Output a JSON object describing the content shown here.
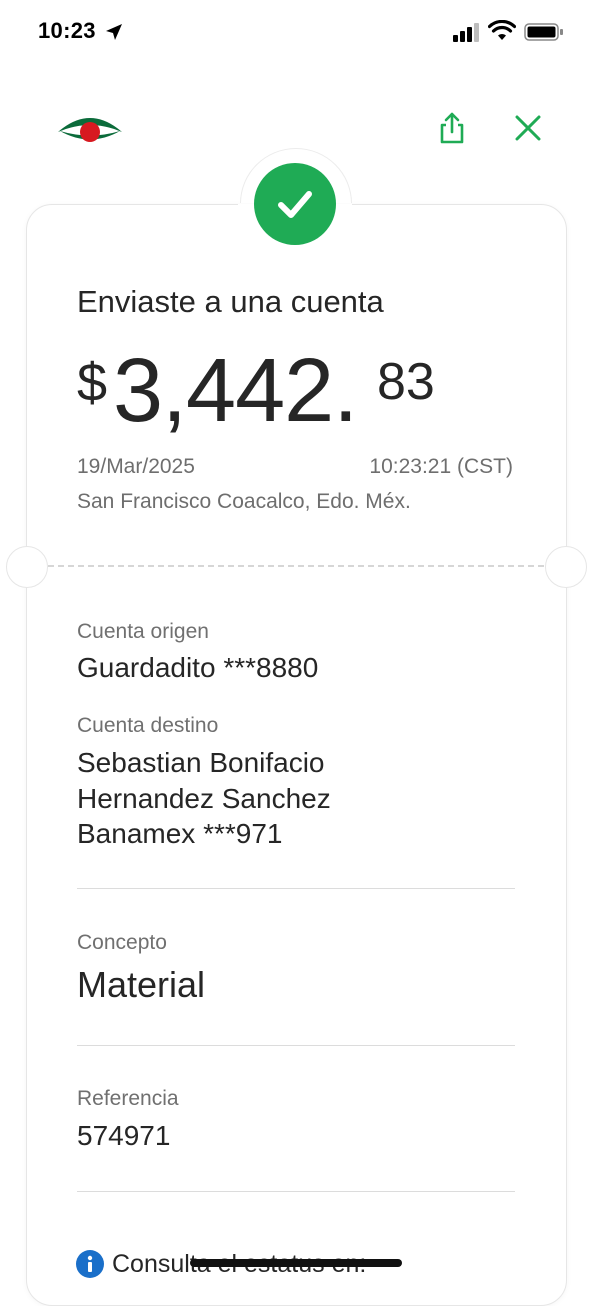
{
  "status_bar": {
    "time": "10:23"
  },
  "header": {},
  "receipt": {
    "title": "Enviaste a una cuenta",
    "amount": {
      "currency": "$",
      "integer": "3,442.",
      "cents": "83"
    },
    "date": "19/Mar/2025",
    "time": "10:23:21 (CST)",
    "location": "San Francisco Coacalco, Edo. Méx."
  },
  "details": {
    "origin_label": "Cuenta origen",
    "origin_value": "Guardadito ***8880",
    "dest_label": "Cuenta destino",
    "dest_line1": "Sebastian Bonifacio",
    "dest_line2": "Hernandez Sanchez",
    "dest_line3": "Banamex ***971",
    "concept_label": "Concepto",
    "concept_value": "Material",
    "reference_label": "Referencia",
    "reference_value": "574971",
    "status_text": "Consulta el estatus en:"
  },
  "colors": {
    "success": "#1fab55",
    "brand_red": "#d71920",
    "brand_green": "#0b6b3a",
    "info": "#1a6fc9"
  }
}
